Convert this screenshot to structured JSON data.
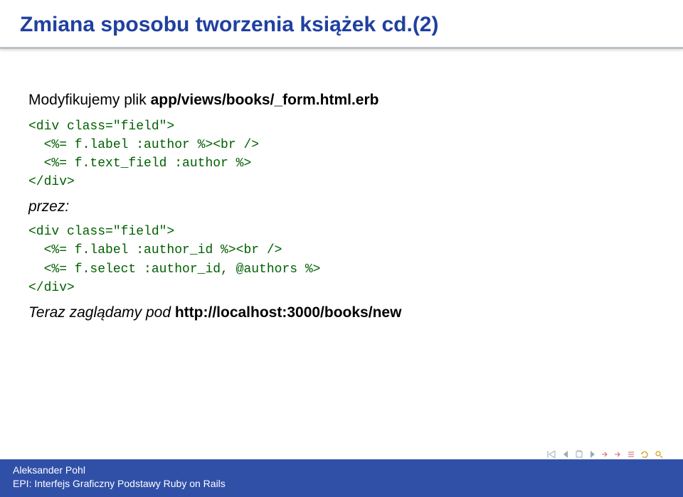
{
  "title": "Zmiana sposobu tworzenia książek cd.(2)",
  "intro_prefix": "Modyfikujemy plik ",
  "intro_path": "app/views/books/_form.html.erb",
  "code1_l1": "<div class=\"field\">",
  "code1_l2": "  <%= f.label :author %><br />",
  "code1_l3": "  <%= f.text_field :author %>",
  "code1_l4": "</div>",
  "przez": "przez:",
  "code2_l1": "<div class=\"field\">",
  "code2_l2": "  <%= f.label :author_id %><br />",
  "code2_l3": "  <%= f.select :author_id, @authors %>",
  "code2_l4": "</div>",
  "outro_prefix": "Teraz zaglądamy pod ",
  "outro_url": "http://localhost:3000/books/new",
  "footer_author": "Aleksander Pohl",
  "footer_title": "EPI: Interfejs Graficzny Podstawy Ruby on Rails"
}
